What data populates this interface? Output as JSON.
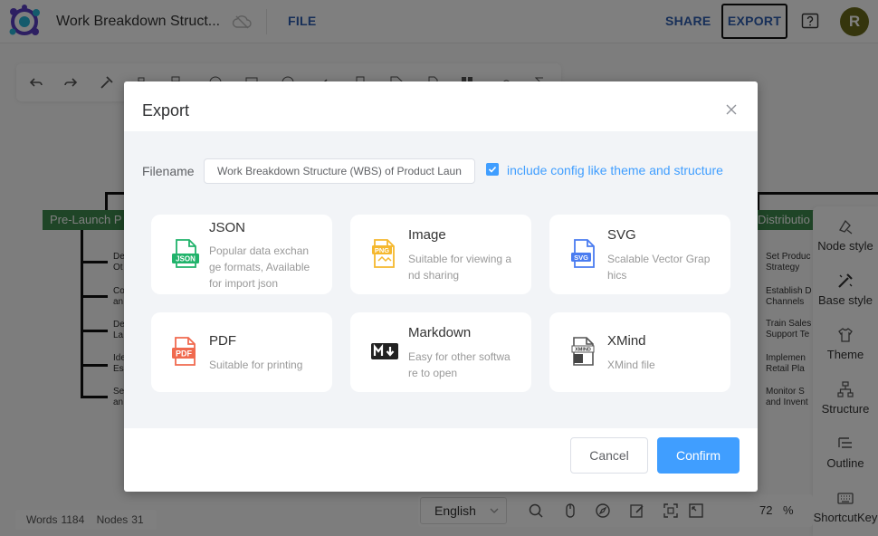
{
  "header": {
    "doc_title": "Work Breakdown Struct...",
    "file_menu": "FILE",
    "share": "SHARE",
    "export": "EXPORT",
    "avatar_initial": "R"
  },
  "mindmap": {
    "left_branch": "Pre-Launch P",
    "right_branch": "Distributio",
    "left_leaves": [
      "De\nOt",
      "Co\nan",
      "De\nLa",
      "Ide\nEs",
      "Se\nan"
    ],
    "right_leaves": [
      "Set Produc\nStrategy",
      "Establish D\nChannels",
      "Train Sales\nSupport Te",
      "Implemen\nRetail Pla",
      "Monitor S\nand Invent"
    ]
  },
  "sidebar": {
    "items": [
      {
        "label": "Node style",
        "icon": "node-style-icon"
      },
      {
        "label": "Base style",
        "icon": "base-style-icon"
      },
      {
        "label": "Theme",
        "icon": "shirt-icon"
      },
      {
        "label": "Structure",
        "icon": "structure-icon"
      },
      {
        "label": "Outline",
        "icon": "outline-icon"
      },
      {
        "label": "ShortcutKey",
        "icon": "keyboard-icon"
      }
    ]
  },
  "status": {
    "words_label": "Words",
    "words": "1184",
    "nodes_label": "Nodes",
    "nodes": "31"
  },
  "bottom_bar": {
    "language": "English",
    "zoom": "72",
    "zoom_unit": "%"
  },
  "modal": {
    "title": "Export",
    "filename_label": "Filename",
    "filename_value": "Work Breakdown Structure (WBS) of Product Launch",
    "include_config_label": "include config like theme and structure",
    "include_config_checked": true,
    "formats": [
      {
        "title": "JSON",
        "desc": "Popular data exchange formats, Available for import json",
        "icon": "json-file-icon"
      },
      {
        "title": "Image",
        "desc": "Suitable for viewing and sharing",
        "icon": "png-file-icon"
      },
      {
        "title": "SVG",
        "desc": "Scalable Vector Graphics",
        "icon": "svg-file-icon"
      },
      {
        "title": "PDF",
        "desc": "Suitable for printing",
        "icon": "pdf-file-icon"
      },
      {
        "title": "Markdown",
        "desc": "Easy for other software to open",
        "icon": "markdown-icon"
      },
      {
        "title": "XMind",
        "desc": "XMind file",
        "icon": "xmind-file-icon"
      }
    ],
    "cancel": "Cancel",
    "confirm": "Confirm"
  },
  "colors": {
    "accent": "#409eff",
    "nav_blue": "#2c5db0",
    "node_green": "#3f8a4e",
    "json_green": "#21b36b",
    "png_yellow": "#f5b82e",
    "svg_blue": "#4a7cf0",
    "pdf_red": "#f06a4f"
  }
}
